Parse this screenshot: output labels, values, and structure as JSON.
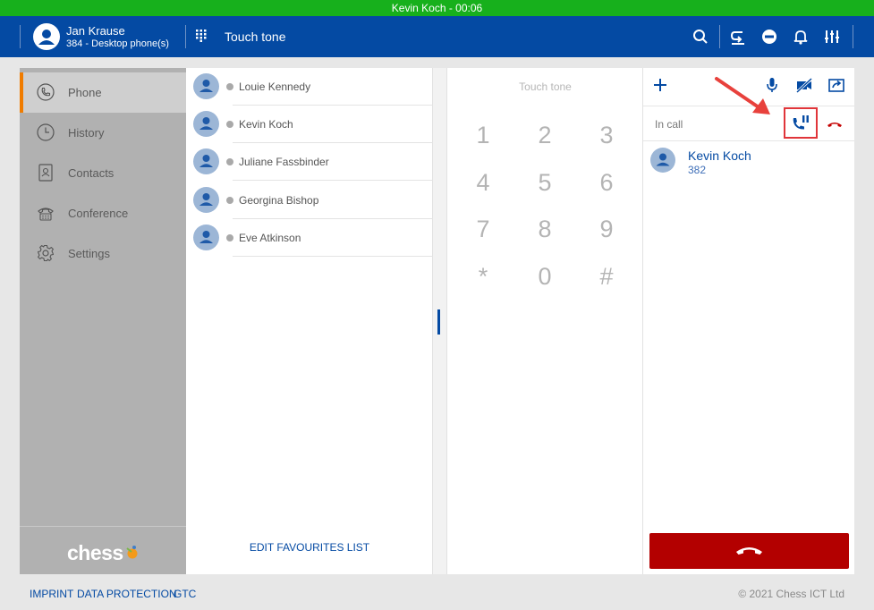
{
  "call_banner": "Kevin Koch - 00:06",
  "header": {
    "user_name": "Jan Krause",
    "user_sub": "384 - Desktop phone(s)",
    "title": "Touch tone"
  },
  "sidebar": {
    "items": [
      {
        "label": "Phone",
        "icon": "phone-icon"
      },
      {
        "label": "History",
        "icon": "clock-icon"
      },
      {
        "label": "Contacts",
        "icon": "contact-card-icon"
      },
      {
        "label": "Conference",
        "icon": "conference-phone-icon"
      },
      {
        "label": "Settings",
        "icon": "gear-icon"
      }
    ],
    "logo": "chess"
  },
  "favourites": {
    "contacts": [
      {
        "name": "Louie Kennedy"
      },
      {
        "name": "Kevin Koch"
      },
      {
        "name": "Juliane Fassbinder"
      },
      {
        "name": "Georgina Bishop"
      },
      {
        "name": "Eve Atkinson"
      }
    ],
    "edit_label": "EDIT FAVOURITES LIST"
  },
  "dialpad": {
    "title": "Touch tone",
    "keys": [
      "1",
      "2",
      "3",
      "4",
      "5",
      "6",
      "7",
      "8",
      "9",
      "*",
      "0",
      "#"
    ]
  },
  "call_panel": {
    "status": "In call",
    "caller_name": "Kevin Koch",
    "caller_number": "382"
  },
  "footer": {
    "links": [
      "IMPRINT",
      "DATA PROTECTION",
      "GTC"
    ],
    "copyright": "© 2021 Chess ICT Ltd"
  },
  "colors": {
    "banner": "#17b01c",
    "header": "#044aa3",
    "accent": "#f07c00",
    "hangup": "#b30000",
    "highlight": "#e0353a"
  }
}
